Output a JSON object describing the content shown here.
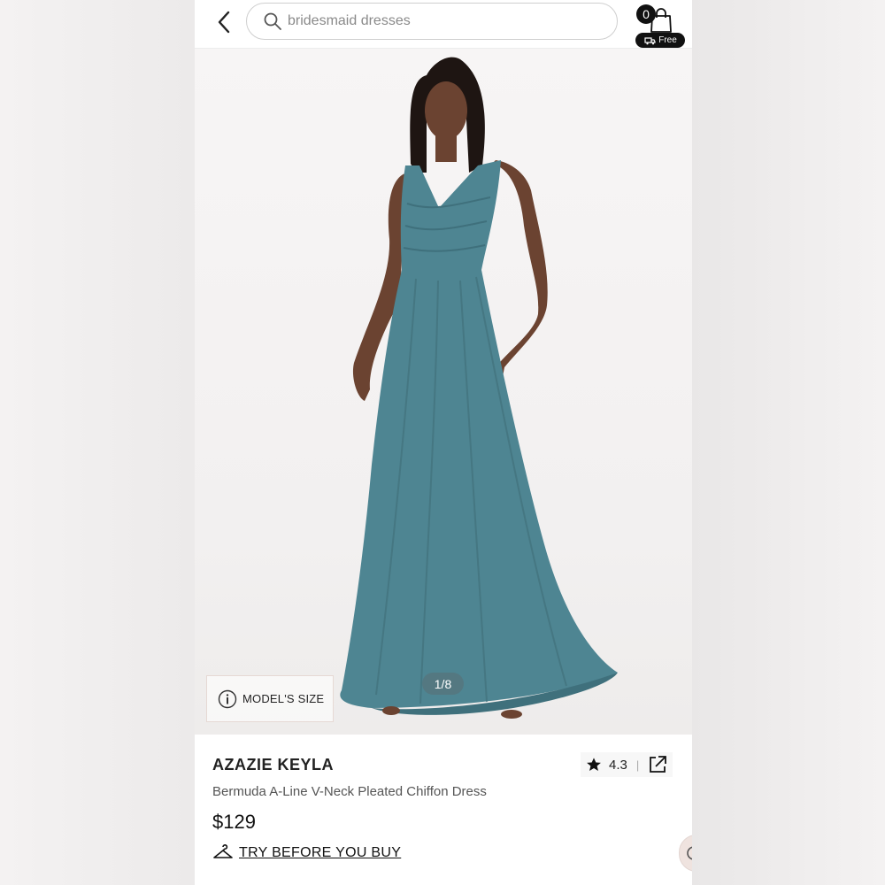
{
  "header": {
    "search": {
      "placeholder": "bridesmaid dresses"
    },
    "cart": {
      "count": "0",
      "shipping_label": "Free"
    }
  },
  "gallery": {
    "counter": "1/8",
    "models_size_label": "MODEL'S SIZE"
  },
  "product": {
    "brand": "AZAZIE KEYLA",
    "name": "Bermuda A-Line V-Neck Pleated Chiffon Dress",
    "price": "$129",
    "rating": "4.3",
    "rating_separator": "|",
    "try_label": "TRY BEFORE YOU BUY"
  },
  "colors": {
    "dress": "#4e8592",
    "accent": "#111111"
  },
  "icons": [
    "chevron-left-icon",
    "search-icon",
    "shopping-bag-icon",
    "truck-icon",
    "info-icon",
    "star-icon",
    "share-icon",
    "hanger-icon",
    "chat-icon"
  ]
}
